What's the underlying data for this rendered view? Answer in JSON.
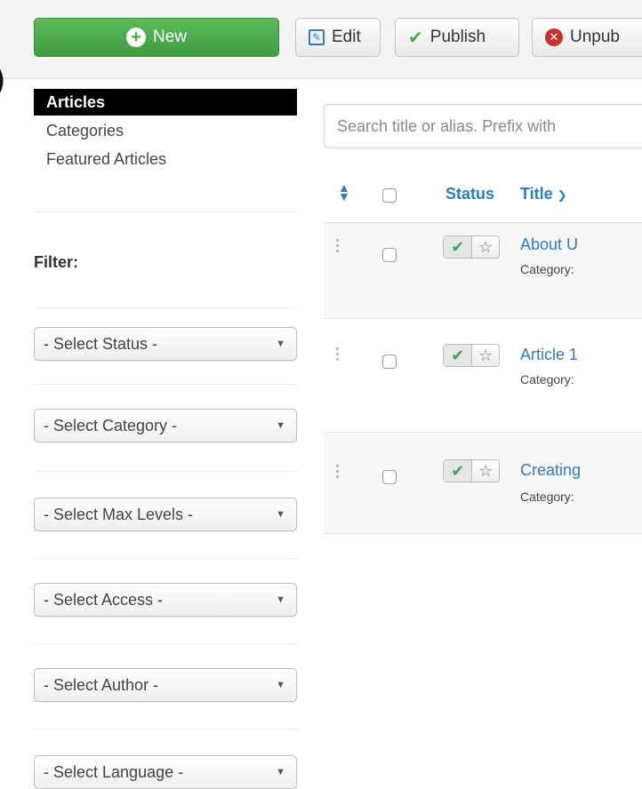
{
  "toolbar": {
    "new_label": "New",
    "edit_label": "Edit",
    "publish_label": "Publish",
    "unpublish_label": "Unpub"
  },
  "colors": {
    "new_button": "#4cae4c",
    "link_blue": "#2f7bbd",
    "publish_check": "#46a546",
    "unpublish_icon": "#c9302c",
    "active_nav": "#000000"
  },
  "sidebar": {
    "items": [
      {
        "label": "Articles",
        "active": true
      },
      {
        "label": "Categories",
        "active": false
      },
      {
        "label": "Featured Articles",
        "active": false
      }
    ],
    "filter_label": "Filter:",
    "filters": [
      {
        "label": "- Select Status -"
      },
      {
        "label": "- Select Category -"
      },
      {
        "label": "- Select Max Levels -"
      },
      {
        "label": "- Select Access -"
      },
      {
        "label": "- Select Author -"
      },
      {
        "label": "- Select Language -"
      }
    ]
  },
  "search": {
    "placeholder": "Search title or alias. Prefix with"
  },
  "table": {
    "headers": {
      "status": "Status",
      "title": "Title"
    },
    "rows": [
      {
        "title": "About U",
        "category": "Category:",
        "published": true,
        "featured": false
      },
      {
        "title": "Article 1",
        "category": "Category:",
        "published": true,
        "featured": false
      },
      {
        "title": "Creating",
        "category": "Category:",
        "published": true,
        "featured": false
      }
    ]
  },
  "icons": {
    "new": "plus-circle-icon",
    "edit": "edit-icon",
    "publish": "check-icon",
    "unpublish": "x-circle-icon",
    "sort": "sort-icon",
    "featured": "star-icon",
    "drag": "drag-handle-icon"
  }
}
